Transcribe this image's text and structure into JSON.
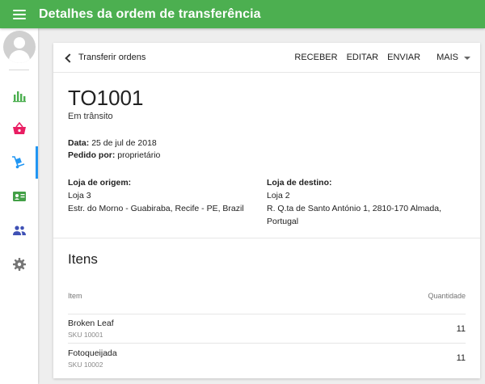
{
  "header": {
    "title": "Detalhes da ordem de transferência"
  },
  "sidebar": {
    "icons": [
      {
        "name": "reports",
        "color": "#4caf50"
      },
      {
        "name": "sales",
        "color": "#e91e63"
      },
      {
        "name": "transfer-orders",
        "color": "#2196f3",
        "active": true
      },
      {
        "name": "catalog",
        "color": "#43a047"
      },
      {
        "name": "customers",
        "color": "#3f51b5"
      },
      {
        "name": "settings",
        "color": "#757575"
      }
    ]
  },
  "toolbar": {
    "back_label": "Transferir ordens",
    "receive_label": "RECEBER",
    "edit_label": "EDITAR",
    "send_label": "ENVIAR",
    "more_label": "MAIS"
  },
  "order": {
    "id": "TO1001",
    "status": "Em trânsito",
    "date_label": "Data:",
    "date_value": "25 de jul de 2018",
    "ordered_by_label": "Pedido por:",
    "ordered_by_value": "proprietário",
    "origin": {
      "label": "Loja de origem:",
      "name": "Loja 3",
      "address": "Estr. do Morno - Guabiraba, Recife - PE, Brazil"
    },
    "destination": {
      "label": "Loja de destino:",
      "name": "Loja 2",
      "address_line1": "R. Q.ta de Santo António 1, 2810-170 Almada,",
      "address_line2": "Portugal"
    }
  },
  "items": {
    "title": "Itens",
    "col_item": "Item",
    "col_qty": "Quantidade",
    "rows": [
      {
        "name": "Broken Leaf",
        "sku": "SKU 10001",
        "qty": "11"
      },
      {
        "name": "Fotoqueijada",
        "sku": "SKU 10002",
        "qty": "11"
      }
    ]
  }
}
